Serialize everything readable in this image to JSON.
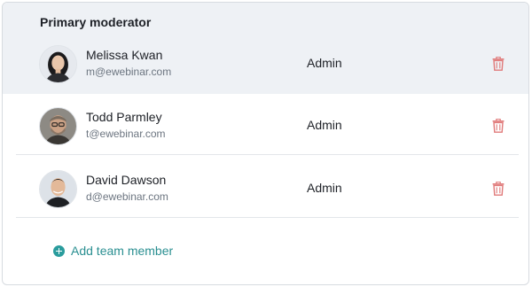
{
  "moderators": {
    "heading": "Primary moderator",
    "members": [
      {
        "name": "Melissa Kwan",
        "email": "m@ewebinar.com",
        "role": "Admin",
        "highlighted": true
      },
      {
        "name": "Todd Parmley",
        "email": "t@ewebinar.com",
        "role": "Admin",
        "highlighted": false
      },
      {
        "name": "David Dawson",
        "email": "d@ewebinar.com",
        "role": "Admin",
        "highlighted": false
      }
    ],
    "add_label": "Add team member"
  },
  "colors": {
    "accent": "#2a9c9d",
    "delete": "#e07a7a",
    "highlight_bg": "#eef1f5"
  },
  "icons": {
    "delete": "trash-icon",
    "add": "plus-circle-icon"
  }
}
